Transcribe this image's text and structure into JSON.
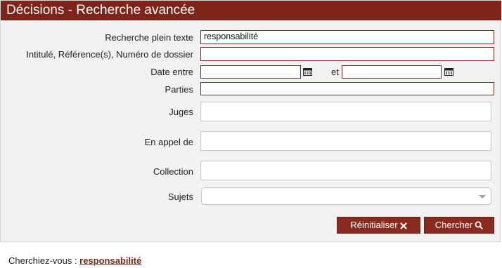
{
  "header": {
    "title": "Décisions - Recherche avancée"
  },
  "form": {
    "fulltext_label": "Recherche plein texte",
    "fulltext_value": "responsabilité",
    "title_ref_label": "Intitulé, Référence(s), Numéro de dossier",
    "title_ref_value": "",
    "date_label": "Date entre",
    "date_from_value": "",
    "date_and_label": "et",
    "date_to_value": "",
    "parties_label": "Parties",
    "parties_value": "",
    "judges_label": "Juges",
    "judges_value": "",
    "appeal_label": "En appel de",
    "appeal_value": "",
    "collection_label": "Collection",
    "collection_value": "",
    "subjects_label": "Sujets",
    "subjects_value": ""
  },
  "buttons": {
    "reset_label": "Réinitialiser",
    "search_label": "Chercher"
  },
  "suggestion": {
    "prefix": "Cherchiez-vous : ",
    "term": "responsabilité"
  },
  "colors": {
    "brand": "#7f2418",
    "button": "#8a2a1e",
    "panel_bg": "#f2f2f2"
  },
  "icons": {
    "calendar": "calendar-icon",
    "reset": "times-icon",
    "search": "search-icon",
    "dropdown": "chevron-down-icon"
  }
}
